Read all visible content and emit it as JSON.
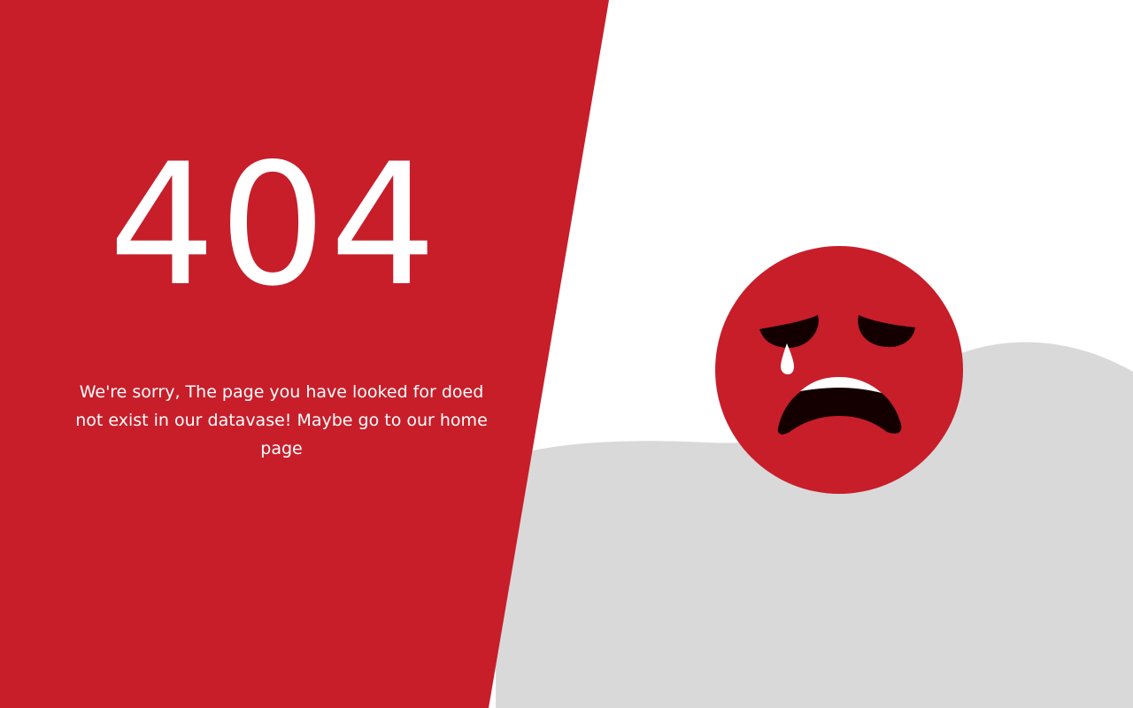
{
  "error": {
    "code": "404"
  },
  "message": {
    "text": "We're sorry, The page you have looked for doed not exist in our datavase! Maybe go to our",
    "link_label": "home page"
  },
  "illustration": {
    "icon": "crying-face-icon"
  },
  "colors": {
    "brand_red": "#c71e2a",
    "hill_gray": "#d9d9d9",
    "background": "#ffffff",
    "text": "#ffffff",
    "face_feature": "#140000"
  }
}
